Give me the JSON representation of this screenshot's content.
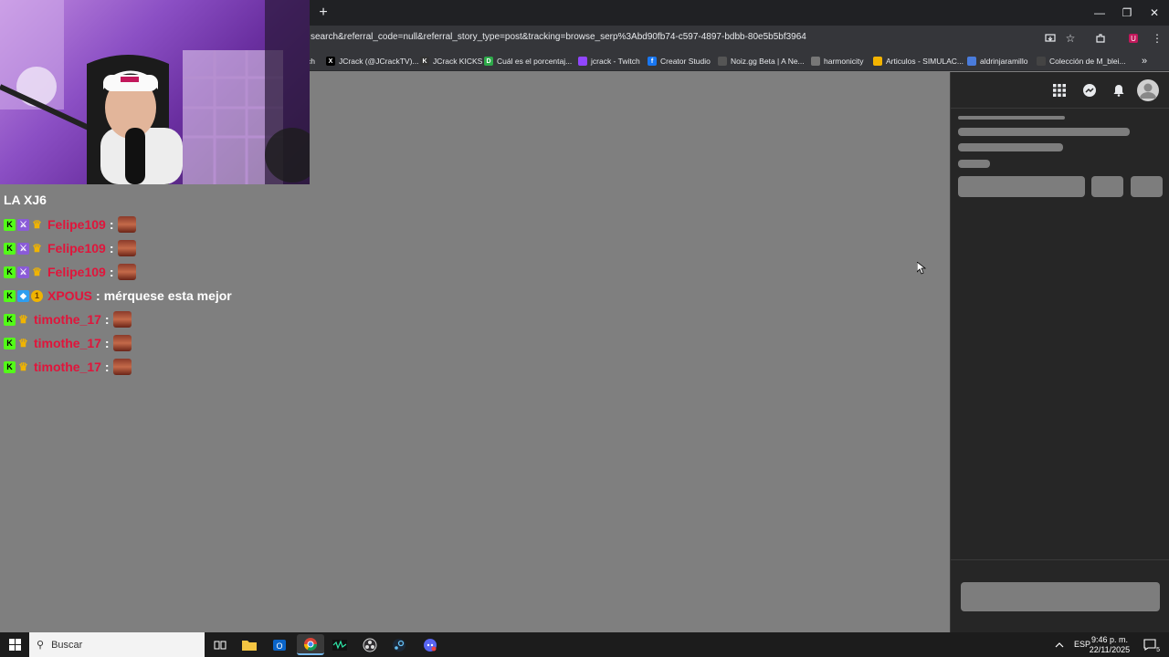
{
  "browser": {
    "new_tab_label": "+",
    "url": "search&referral_code=null&referral_story_type=post&tracking=browse_serp%3Abd90fb74-c597-4897-bdbb-80e5b5bf3964",
    "window_controls": [
      "—",
      "❐",
      "✕"
    ]
  },
  "bookmarks": [
    {
      "label": "ch",
      "icon": "twitch-icon"
    },
    {
      "label": "JCrack (@JCrackTV)...",
      "icon": "x-icon"
    },
    {
      "label": "JCrack KICKS",
      "icon": "kick-icon"
    },
    {
      "label": "Cuál es el porcentaj...",
      "icon": "doc-icon"
    },
    {
      "label": "jcrack - Twitch",
      "icon": "twitch-icon"
    },
    {
      "label": "Creator Studio",
      "icon": "facebook-icon"
    },
    {
      "label": "Noiz.gg Beta | A Ne...",
      "icon": "noiz-icon"
    },
    {
      "label": "harmonicity",
      "icon": "harmonicity-icon"
    },
    {
      "label": "Articulos - SIMULAC...",
      "icon": "drive-icon"
    },
    {
      "label": "aldrinjaramillo",
      "icon": "aldrin-icon"
    },
    {
      "label": "Colección de M_blei...",
      "icon": "collection-icon"
    }
  ],
  "chat": {
    "top_line": "LA XJ6",
    "messages": [
      {
        "user": "Felipe109",
        "text": "",
        "badges": [
          "kick",
          "mod",
          "crown"
        ],
        "emote": true
      },
      {
        "user": "Felipe109",
        "text": "",
        "badges": [
          "kick",
          "mod",
          "crown"
        ],
        "emote": true
      },
      {
        "user": "Felipe109",
        "text": "",
        "badges": [
          "kick",
          "mod",
          "crown"
        ],
        "emote": true
      },
      {
        "user": "XPOUS",
        "text": "mérquese esta mejor",
        "badges": [
          "kick",
          "cube",
          "coin"
        ],
        "emote": false
      },
      {
        "user": "timothe_17",
        "text": "",
        "badges": [
          "kick",
          "crown"
        ],
        "emote": true
      },
      {
        "user": "timothe_17",
        "text": "",
        "badges": [
          "kick",
          "crown"
        ],
        "emote": true
      },
      {
        "user": "timothe_17",
        "text": "",
        "badges": [
          "kick",
          "crown"
        ],
        "emote": true
      }
    ],
    "separator": ":"
  },
  "taskbar": {
    "search_placeholder": "Buscar",
    "language": "ESP",
    "time": "9:46 p. m.",
    "date": "22/11/2025",
    "notification_count": "5"
  },
  "colors": {
    "page_bg": "#7f7f7f",
    "panel_bg": "#262626",
    "username": "#e0153b",
    "kick_green": "#53fc18"
  }
}
